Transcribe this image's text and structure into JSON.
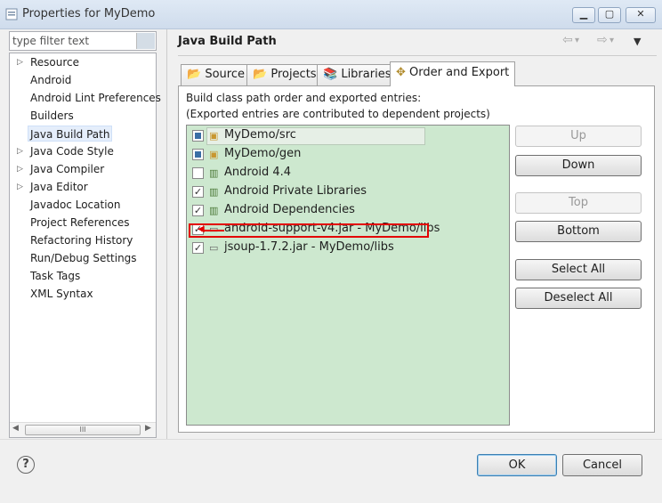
{
  "window": {
    "title": "Properties for MyDemo",
    "minimize_icon": "minimize-icon",
    "maximize_icon": "maximize-icon",
    "close_icon": "close-icon"
  },
  "filter": {
    "placeholder": "type filter text"
  },
  "tree": {
    "items": [
      {
        "label": "Resource",
        "expandable": true
      },
      {
        "label": "Android",
        "expandable": false
      },
      {
        "label": "Android Lint Preferences",
        "expandable": false
      },
      {
        "label": "Builders",
        "expandable": false
      },
      {
        "label": "Java Build Path",
        "expandable": false,
        "selected": true
      },
      {
        "label": "Java Code Style",
        "expandable": true
      },
      {
        "label": "Java Compiler",
        "expandable": true
      },
      {
        "label": "Java Editor",
        "expandable": true
      },
      {
        "label": "Javadoc Location",
        "expandable": false
      },
      {
        "label": "Project References",
        "expandable": false
      },
      {
        "label": "Refactoring History",
        "expandable": false
      },
      {
        "label": "Run/Debug Settings",
        "expandable": false
      },
      {
        "label": "Task Tags",
        "expandable": false
      },
      {
        "label": "XML Syntax",
        "expandable": false
      }
    ],
    "scroll_thumb": "III"
  },
  "page": {
    "title": "Java Build Path"
  },
  "tabs": [
    {
      "label": "Source",
      "icon": "source-folder-icon"
    },
    {
      "label": "Projects",
      "icon": "projects-icon"
    },
    {
      "label": "Libraries",
      "icon": "libraries-icon"
    },
    {
      "label": "Order and Export",
      "icon": "order-export-icon",
      "active": true
    }
  ],
  "description": {
    "line1": "Build class path order and exported entries:",
    "line2": "(Exported entries are contributed to dependent projects)"
  },
  "entries": [
    {
      "label": "MyDemo/src",
      "checked": "partial",
      "icon": "source-folder-icon"
    },
    {
      "label": "MyDemo/gen",
      "checked": "partial",
      "icon": "source-folder-icon"
    },
    {
      "label": "Android 4.4",
      "checked": false,
      "icon": "library-icon"
    },
    {
      "label": "Android Private Libraries",
      "checked": true,
      "icon": "library-icon"
    },
    {
      "label": "Android Dependencies",
      "checked": true,
      "icon": "library-icon"
    },
    {
      "label": "android-support-v4.jar - MyDemo/libs",
      "checked": true,
      "icon": "jar-icon",
      "highlighted": true
    },
    {
      "label": "jsoup-1.7.2.jar - MyDemo/libs",
      "checked": true,
      "icon": "jar-icon"
    }
  ],
  "buttons": {
    "up": "Up",
    "down": "Down",
    "top": "Top",
    "bottom": "Bottom",
    "select_all": "Select All",
    "deselect_all": "Deselect All"
  },
  "dialog": {
    "ok": "OK",
    "cancel": "Cancel",
    "help": "?"
  },
  "colors": {
    "list_bg": "#cde8cf",
    "highlight": "#e30000"
  }
}
